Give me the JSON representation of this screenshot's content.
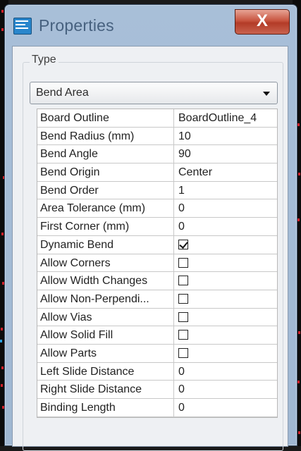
{
  "window": {
    "title": "Properties",
    "close_label": "X",
    "icon": "application-icon",
    "accent_color": "#2a86cc"
  },
  "type_group": {
    "label": "Type",
    "selected": "Bend Area"
  },
  "properties": [
    {
      "name": "Board Outline",
      "kind": "text",
      "value": "BoardOutline_4"
    },
    {
      "name": "Bend Radius (mm)",
      "kind": "text",
      "value": "10"
    },
    {
      "name": "Bend Angle",
      "kind": "text",
      "value": "90"
    },
    {
      "name": "Bend Origin",
      "kind": "text",
      "value": "Center"
    },
    {
      "name": "Bend Order",
      "kind": "text",
      "value": "1"
    },
    {
      "name": "Area Tolerance (mm)",
      "kind": "text",
      "value": "0"
    },
    {
      "name": "First Corner (mm)",
      "kind": "text",
      "value": "0"
    },
    {
      "name": "Dynamic Bend",
      "kind": "checkbox",
      "checked": true
    },
    {
      "name": "Allow Corners",
      "kind": "checkbox",
      "checked": false
    },
    {
      "name": "Allow Width Changes",
      "kind": "checkbox",
      "checked": false
    },
    {
      "name": "Allow Non-Perpendi...",
      "kind": "checkbox",
      "checked": false
    },
    {
      "name": "Allow Vias",
      "kind": "checkbox",
      "checked": false
    },
    {
      "name": "Allow Solid Fill",
      "kind": "checkbox",
      "checked": false
    },
    {
      "name": "Allow Parts",
      "kind": "checkbox",
      "checked": false
    },
    {
      "name": "Left Slide Distance",
      "kind": "text",
      "value": "0"
    },
    {
      "name": "Right Slide Distance",
      "kind": "text",
      "value": "0"
    },
    {
      "name": "Binding Length",
      "kind": "text",
      "value": "0"
    }
  ]
}
